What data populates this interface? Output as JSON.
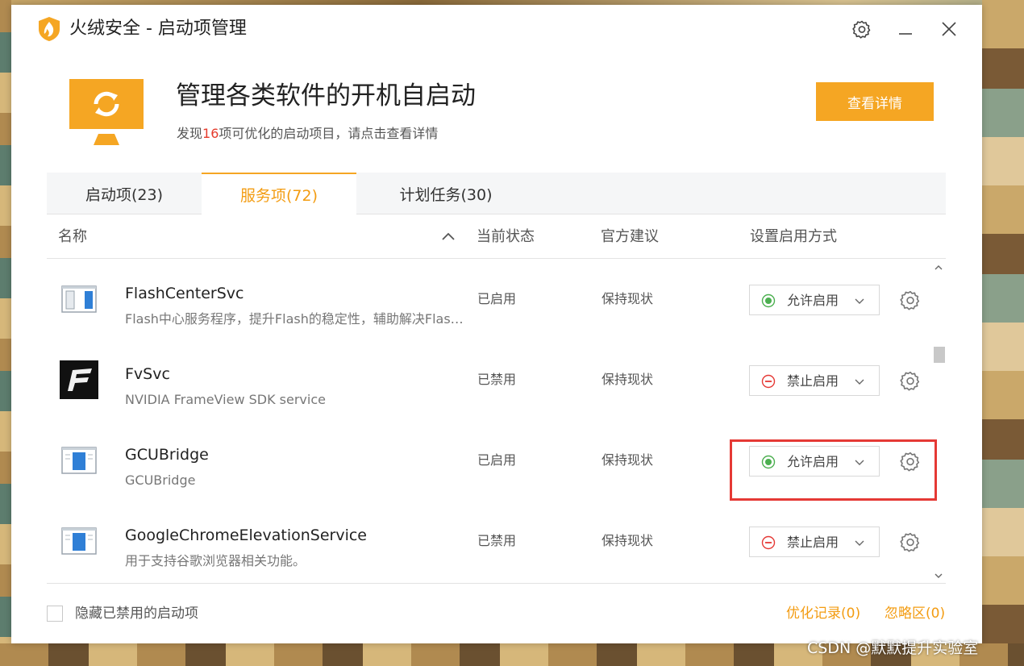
{
  "window": {
    "title": "火绒安全 - 启动项管理"
  },
  "hero": {
    "title": "管理各类软件的开机自启动",
    "subtitle_prefix": "发现",
    "subtitle_count": "16",
    "subtitle_suffix": "项可优化的启动项目，请点击查看详情",
    "detail_button": "查看详情"
  },
  "tabs": [
    {
      "label": "启动项(23)",
      "active": false
    },
    {
      "label": "服务项(72)",
      "active": true
    },
    {
      "label": "计划任务(30)",
      "active": false
    }
  ],
  "columns": {
    "name": "名称",
    "state": "当前状态",
    "advice": "官方建议",
    "mode": "设置启用方式"
  },
  "rows": [
    {
      "name": "FlashCenterSvc",
      "desc": "Flash中心服务程序，提升Flash的稳定性，辅助解决Flash问题",
      "state": "已启用",
      "advice": "保持现状",
      "mode": "允许启用",
      "icon": "window-app-icon"
    },
    {
      "name": "FvSvc",
      "desc": "NVIDIA FrameView SDK service",
      "state": "已禁用",
      "advice": "保持现状",
      "mode": "禁止启用",
      "icon": "frameview-icon"
    },
    {
      "name": "GCUBridge",
      "desc": "GCUBridge",
      "state": "已启用",
      "advice": "保持现状",
      "mode": "允许启用",
      "icon": "window-app-icon"
    },
    {
      "name": "GoogleChromeElevationService",
      "desc": "用于支持谷歌浏览器相关功能。",
      "state": "已禁用",
      "advice": "保持现状",
      "mode": "禁止启用",
      "icon": "window-app-icon"
    }
  ],
  "footer": {
    "hide_disabled_label": "隐藏已禁用的启动项",
    "optimize_record": "优化记录(0)",
    "ignore_zone": "忽略区(0)"
  },
  "watermark": "CSDN @默默提升实验室",
  "colors": {
    "accent": "#f5a623",
    "allow": "#4caf50",
    "deny": "#e53935",
    "highlight": "#e53935"
  }
}
